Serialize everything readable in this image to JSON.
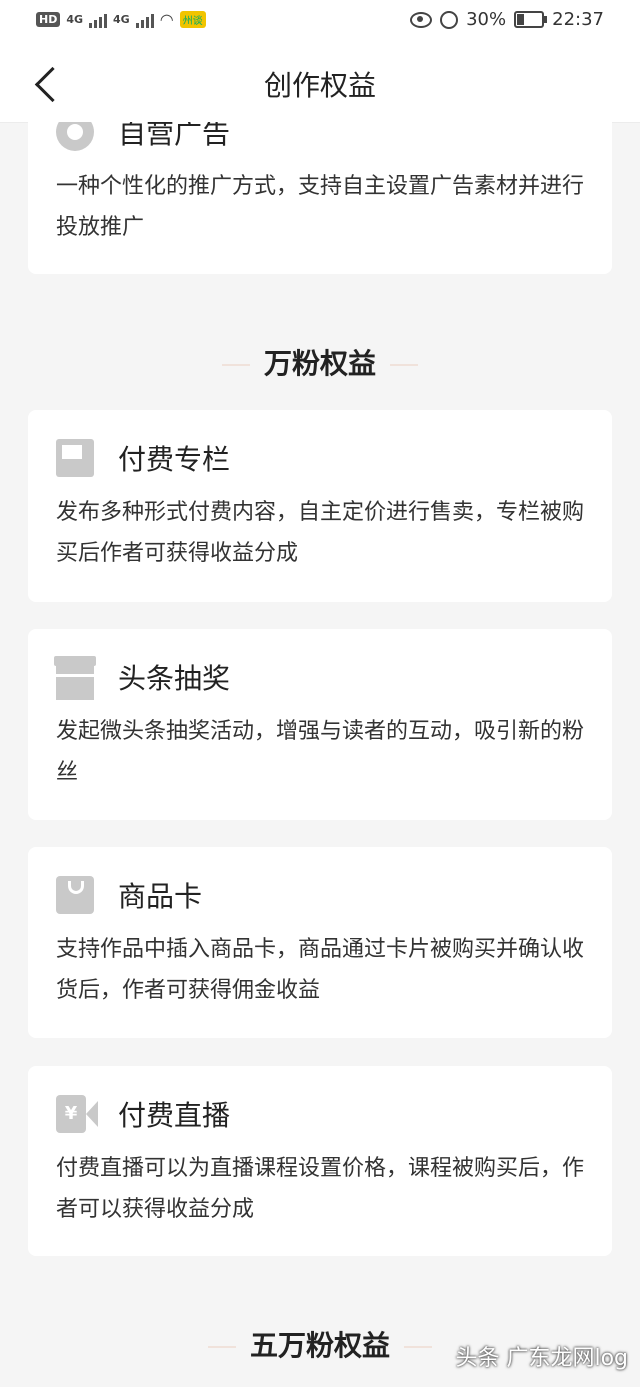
{
  "status_bar": {
    "hd": "HD",
    "network": "4G",
    "app_chip": "州谈",
    "battery": "30%",
    "battery_level": 0.3,
    "time": "22:37"
  },
  "nav": {
    "title": "创作权益"
  },
  "cards_top": [
    {
      "icon": "disc-icon",
      "title": "自营广告",
      "desc": "一种个性化的推广方式，支持自主设置广告素材并进行投放推广"
    }
  ],
  "section_wanfen": {
    "title": "万粉权益"
  },
  "cards": [
    {
      "icon": "column-icon",
      "title": "付费专栏",
      "desc": "发布多种形式付费内容，自主定价进行售卖，专栏被购买后作者可获得收益分成"
    },
    {
      "icon": "gift-icon",
      "title": "头条抽奖",
      "desc": "发起微头条抽奖活动，增强与读者的互动，吸引新的粉丝"
    },
    {
      "icon": "shopping-bag-icon",
      "title": "商品卡",
      "desc": "支持作品中插入商品卡，商品通过卡片被购买并确认收货后，作者可获得佣金收益"
    },
    {
      "icon": "paid-live-icon",
      "title": "付费直播",
      "icon_glyph": "¥",
      "desc": "付费直播可以为直播课程设置价格，课程被购买后，作者可以获得收益分成"
    }
  ],
  "section_wuwanfen": {
    "title": "五万粉权益"
  },
  "watermark": "头条 广东龙网log"
}
